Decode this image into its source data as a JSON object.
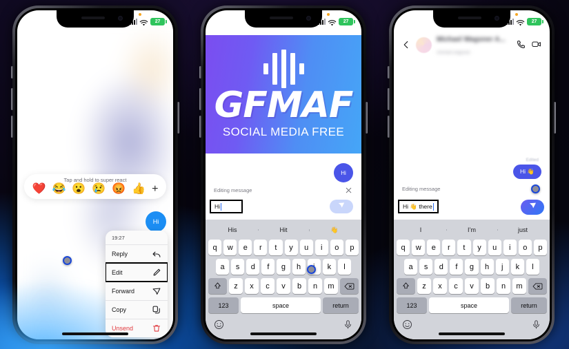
{
  "status_bar": {
    "battery_label": "27",
    "signal_icon": "cellular-signal-icon",
    "wifi_icon": "wifi-icon",
    "battery_icon": "battery-icon"
  },
  "phone1": {
    "reaction_bar": {
      "hint": "Tap and hold to super react",
      "emojis": [
        "❤️",
        "😂",
        "😮",
        "😢",
        "😡",
        "👍"
      ],
      "plus": "+"
    },
    "message_bubble": "Hi",
    "context_menu": {
      "time": "19:27",
      "items": [
        {
          "label": "Reply",
          "icon": "reply-arrow-icon"
        },
        {
          "label": "Edit",
          "icon": "pencil-icon"
        },
        {
          "label": "Forward",
          "icon": "send-arrow-icon"
        },
        {
          "label": "Copy",
          "icon": "copy-icon"
        },
        {
          "label": "Unsend",
          "icon": "trash-icon"
        }
      ],
      "highlighted_item": "Edit",
      "danger_item": "Unsend"
    }
  },
  "phone2": {
    "banner": {
      "title": "GFMAF",
      "subtitle": "SOCIAL MEDIA FREE",
      "bar_count": 5
    },
    "message_bubble": "Hi",
    "editing_label": "Editing message",
    "close_icon": "close-x-icon",
    "input_value": "Hi",
    "send_icon": "send-paper-plane-icon",
    "keyboard": {
      "suggestions": [
        "His",
        "Hit",
        "👋"
      ],
      "row1": [
        "q",
        "w",
        "e",
        "r",
        "t",
        "y",
        "u",
        "i",
        "o",
        "p"
      ],
      "row2": [
        "a",
        "s",
        "d",
        "f",
        "g",
        "h",
        "j",
        "k",
        "l"
      ],
      "row3": [
        "z",
        "x",
        "c",
        "v",
        "b",
        "n",
        "m"
      ],
      "shift_icon": "shift-arrow-icon",
      "backspace_icon": "backspace-icon",
      "numeric_label": "123",
      "space_label": "space",
      "return_label": "return",
      "emoji_icon": "emoji-smiley-icon",
      "mic_icon": "microphone-icon"
    }
  },
  "phone3": {
    "navbar": {
      "back_icon": "chevron-left-icon",
      "avatar": "contact-avatar",
      "title": "Michael Wagoner A...",
      "subtitle": "michael.wagoner",
      "call_icon": "phone-call-icon",
      "video_icon": "video-camera-icon"
    },
    "edited_tag": "Edited",
    "message_bubble": "Hi 👋",
    "editing_label": "Editing message",
    "input_value": "Hi 👋 there",
    "send_icon": "send-paper-plane-icon",
    "keyboard": {
      "suggestions": [
        "I",
        "I’m",
        "just"
      ],
      "row1": [
        "q",
        "w",
        "e",
        "r",
        "t",
        "y",
        "u",
        "i",
        "o",
        "p"
      ],
      "row2": [
        "a",
        "s",
        "d",
        "f",
        "g",
        "h",
        "j",
        "k",
        "l"
      ],
      "row3": [
        "z",
        "x",
        "c",
        "v",
        "b",
        "n",
        "m"
      ],
      "shift_icon": "shift-arrow-icon",
      "backspace_icon": "backspace-icon",
      "numeric_label": "123",
      "space_label": "space",
      "return_label": "return",
      "emoji_icon": "emoji-smiley-icon",
      "mic_icon": "microphone-icon"
    }
  },
  "colors": {
    "accent_blue": "#1c8ef4",
    "bubble_indigo": "#4a55e8",
    "danger_red": "#e0393e",
    "battery_green": "#2fc45c",
    "banner_from": "#7b4df0",
    "banner_to": "#45a6f7"
  }
}
